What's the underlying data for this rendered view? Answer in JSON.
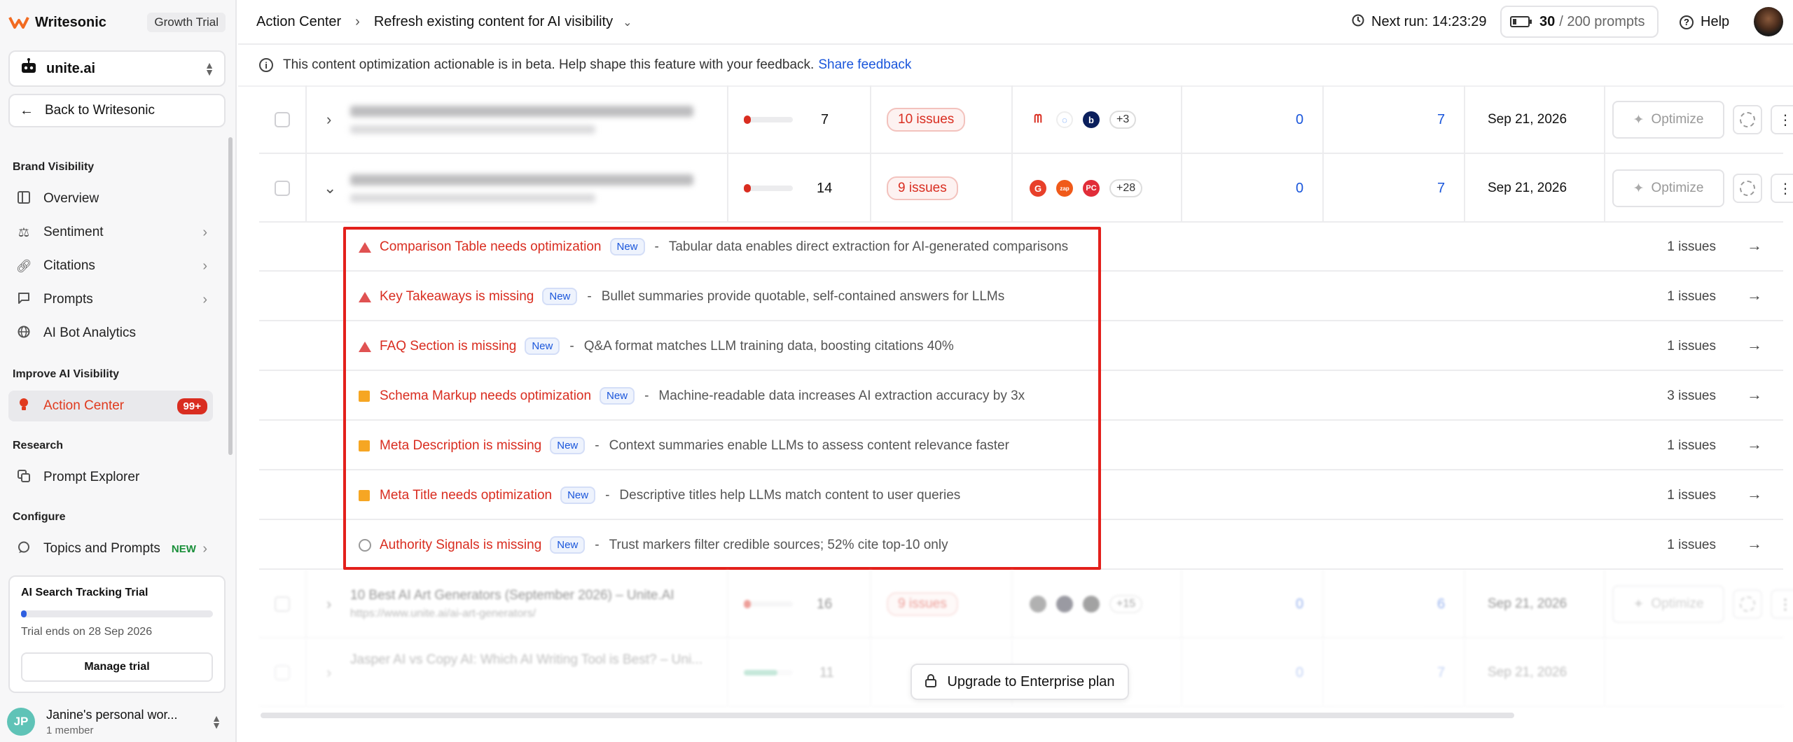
{
  "sidebar": {
    "brand": "Writesonic",
    "plan_badge": "Growth Trial",
    "workspace": "unite.ai",
    "back_label": "Back to Writesonic",
    "sections": {
      "brand_visibility": "Brand Visibility",
      "improve": "Improve AI Visibility",
      "research": "Research",
      "configure": "Configure"
    },
    "items": [
      {
        "label": "Overview",
        "icon": "layout-icon"
      },
      {
        "label": "Sentiment",
        "icon": "scale-icon"
      },
      {
        "label": "Citations",
        "icon": "link-icon"
      },
      {
        "label": "Prompts",
        "icon": "chat-icon"
      },
      {
        "label": "AI Bot Analytics",
        "icon": "globe-icon"
      },
      {
        "label": "Action Center",
        "icon": "lightbulb-icon",
        "badge": "99+"
      },
      {
        "label": "Prompt Explorer",
        "icon": "explorer-icon"
      },
      {
        "label": "Topics and Prompts",
        "icon": "chat-icon",
        "tag": "NEW"
      }
    ],
    "trial": {
      "title": "AI Search Tracking Trial",
      "progress": 0.03,
      "ends": "Trial ends on 28 Sep 2026",
      "manage": "Manage trial"
    },
    "user": {
      "initials": "JP",
      "name": "Janine's personal wor...",
      "members": "1 member"
    }
  },
  "topbar": {
    "crumb_root": "Action Center",
    "crumb_current": "Refresh existing content for AI visibility",
    "next_run": "Next run: 14:23:29",
    "prompts_used": "30",
    "prompts_total": "/ 200 prompts",
    "help": "Help"
  },
  "banner": {
    "text": "This content optimization actionable is in beta. Help shape this feature with your feedback.",
    "link": "Share feedback"
  },
  "rows": [
    {
      "score": "7",
      "issues": "10 issues",
      "plus": "+3",
      "c1": "0",
      "c2": "7",
      "date": "Sep 21, 2026",
      "optimize": "Optimize"
    },
    {
      "score": "14",
      "issues": "9 issues",
      "plus": "+28",
      "c1": "0",
      "c2": "7",
      "date": "Sep 21, 2026",
      "optimize": "Optimize"
    }
  ],
  "details": [
    {
      "marker": "triangle",
      "title": "Comparison Table needs optimization",
      "tag": "New",
      "desc": "Tabular data enables direct extraction for AI-generated comparisons",
      "count": "1 issues"
    },
    {
      "marker": "triangle",
      "title": "Key Takeaways is missing",
      "tag": "New",
      "desc": "Bullet summaries provide quotable, self-contained answers for LLMs",
      "count": "1 issues"
    },
    {
      "marker": "triangle",
      "title": "FAQ Section is missing",
      "tag": "New",
      "desc": "Q&A format matches LLM training data, boosting citations 40%",
      "count": "1 issues"
    },
    {
      "marker": "square",
      "title": "Schema Markup needs optimization",
      "tag": "New",
      "desc": "Machine-readable data increases AI extraction accuracy by 3x",
      "count": "3 issues"
    },
    {
      "marker": "square",
      "title": "Meta Description is missing",
      "tag": "New",
      "desc": "Context summaries enable LLMs to assess content relevance faster",
      "count": "1 issues"
    },
    {
      "marker": "square",
      "title": "Meta Title needs optimization",
      "tag": "New",
      "desc": "Descriptive titles help LLMs match content to user queries",
      "count": "1 issues"
    },
    {
      "marker": "circle",
      "title": "Authority Signals is missing",
      "tag": "New",
      "desc": "Trust markers filter credible sources; 52% cite top-10 only",
      "count": "1 issues"
    }
  ],
  "faded_rows": [
    {
      "title": "10 Best AI Art Generators (September 2026) – Unite.AI",
      "url": "https://www.unite.ai/ai-art-generators/",
      "score": "16",
      "issues": "9 issues",
      "plus": "+15",
      "c1": "0",
      "c2": "6",
      "date": "Sep 21, 2026",
      "optimize": "Optimize"
    },
    {
      "title": "Jasper AI vs Copy AI: Which AI Writing Tool is Best? – Uni...",
      "score": "11",
      "c1": "0",
      "c2": "7",
      "date": "Sep 21, 2026"
    }
  ],
  "upgrade_label": "Upgrade to Enterprise plan",
  "colors": {
    "accent": "#e03a1e",
    "link": "#1a56db",
    "issue_red": "#d92d20",
    "warn_orange": "#f6a623",
    "highlight_box": "#e3201b"
  }
}
